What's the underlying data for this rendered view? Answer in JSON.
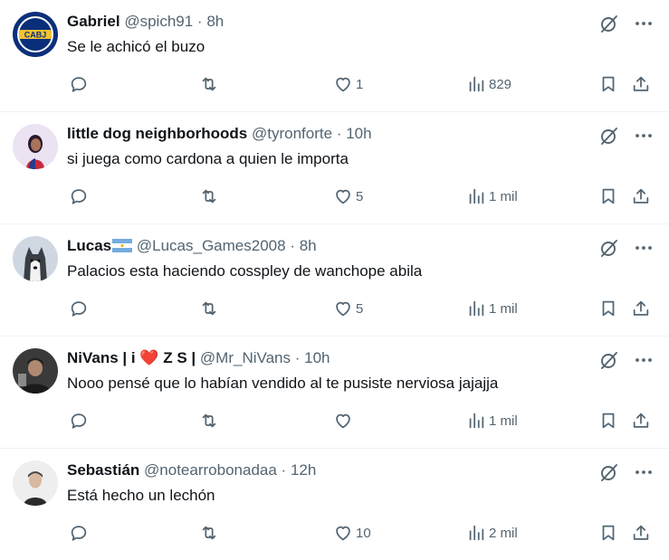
{
  "tweets": [
    {
      "name": "Gabriel",
      "handle": "@spich91",
      "sep": "·",
      "time": "8h",
      "text": "Se le achicó el buzo",
      "replies": "",
      "retweets": "",
      "likes": "1",
      "views": "829",
      "avatar_colors": [
        "#0a2f7a",
        "#f2c230"
      ],
      "avatar_text": "CABJ"
    },
    {
      "name": "little dog neighborhoods",
      "handle": "@tyronforte",
      "sep": "·",
      "time": "10h",
      "text": "si juega como cardona a quien le importa",
      "replies": "",
      "retweets": "",
      "likes": "5",
      "views": "1 mil",
      "avatar_colors": [
        "#e9dff0",
        "#2a1a4a"
      ]
    },
    {
      "name": "Lucas",
      "flag": "argentina-flag",
      "handle": "@Lucas_Games2008",
      "sep": "·",
      "time": "8h",
      "text": "Palacios esta haciendo cosspley de wanchope abila",
      "replies": "",
      "retweets": "",
      "likes": "5",
      "views": "1 mil",
      "avatar_colors": [
        "#c9d3dc",
        "#3a3f45"
      ]
    },
    {
      "name": "NiVans | i",
      "name_heart": "❤️",
      "name_tail": " Z S | ",
      "handle": "@Mr_NiVans",
      "sep": "·",
      "time": "10h",
      "text": "Nooo pensé que lo habían vendido al te pusiste nerviosa jajajja",
      "replies": "",
      "retweets": "",
      "likes": "",
      "views": "1 mil",
      "avatar_colors": [
        "#2b2b2b",
        "#9a9a9a"
      ]
    },
    {
      "name": "Sebastián",
      "handle": "@notearrobonadaa",
      "sep": "·",
      "time": "12h",
      "text": "Está hecho un lechón",
      "replies": "",
      "retweets": "",
      "likes": "10",
      "views": "2 mil",
      "avatar_colors": [
        "#e8e8e8",
        "#333333"
      ]
    }
  ],
  "icons": {
    "grok": "grok-icon",
    "more": "more-icon",
    "reply": "reply-icon",
    "retweet": "retweet-icon",
    "like": "like-icon",
    "views": "views-icon",
    "bookmark": "bookmark-icon",
    "share": "share-icon"
  }
}
